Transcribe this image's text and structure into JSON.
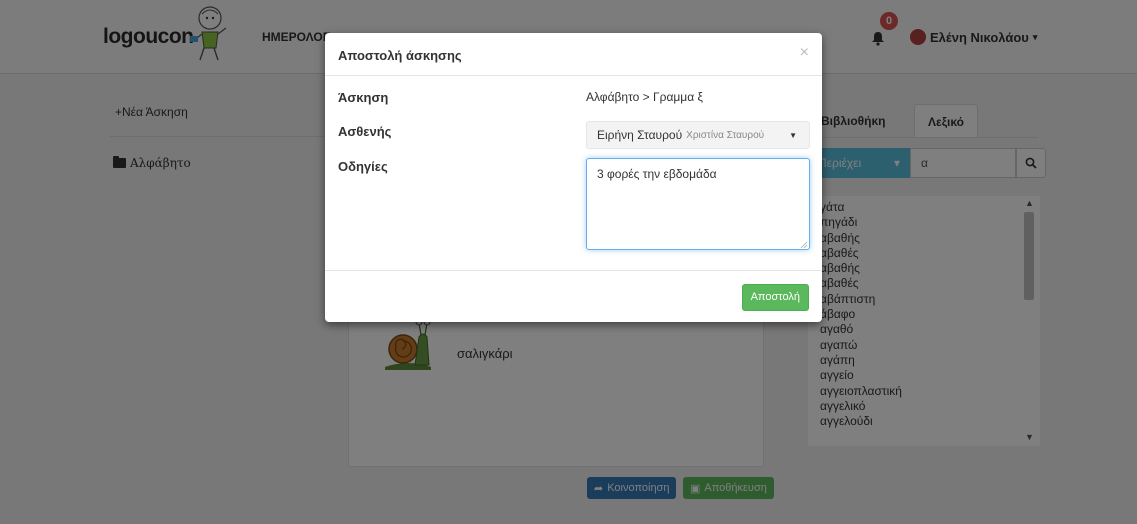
{
  "navbar": {
    "logo": "logoucon",
    "nav_link": "ΗΜΕΡΟΛΟΓ",
    "notifications_count": "0",
    "user_name": "Ελένη Νικολάου"
  },
  "sidebar": {
    "new_exercise": "Νέα Άσκηση",
    "folders": [
      {
        "label": "Αλφάβητο"
      }
    ]
  },
  "exercise_panel": {
    "item_word": "σαλιγκάρι",
    "share_label": "Κοινοποίηση",
    "save_label": "Αποθήκευση"
  },
  "lexicon": {
    "tabs": [
      {
        "label": "Βιβλιοθήκη",
        "active": false
      },
      {
        "label": "Λεξικό",
        "active": true
      }
    ],
    "filter": "Περιέχει",
    "query": "α",
    "words": [
      "γάτα",
      "πηγάδι",
      "αβαθής",
      "αβαθές",
      "αβαθής",
      "αβαθές",
      "αβάπτιστη",
      "άβαφο",
      "αγαθό",
      "αγαπώ",
      "αγάπη",
      "αγγείο",
      "αγγειοπλαστική",
      "αγγελικό",
      "αγγελούδι"
    ]
  },
  "modal": {
    "title": "Αποστολή άσκησης",
    "exercise_label": "Άσκηση",
    "exercise_value": "Αλφάβητο > Γραμμα ξ",
    "patient_label": "Ασθενής",
    "patient_name": "Ειρήνη Σταυρού",
    "patient_sub": "Χριστίνα Σταυρού",
    "instructions_label": "Οδηγίες",
    "instructions_value": "3 φορές την εβδομάδα",
    "send_label": "Αποστολή"
  },
  "colors": {
    "primary": "#337ab7",
    "success": "#5cb85c",
    "info": "#5bc0de",
    "danger": "#d9534f"
  }
}
